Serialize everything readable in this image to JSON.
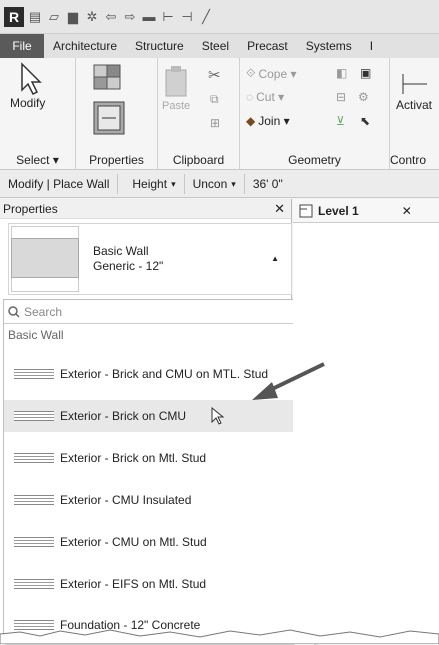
{
  "qat": {
    "logo": "R"
  },
  "tabs": [
    "File",
    "Architecture",
    "Structure",
    "Steel",
    "Precast",
    "Systems",
    "I"
  ],
  "ribbon": {
    "select": {
      "modify": "Modify",
      "label": "Select ▾"
    },
    "properties": {
      "label": "Properties"
    },
    "clipboard": {
      "paste": "Paste",
      "label": "Clipboard"
    },
    "geometry": {
      "cope": "Cope ▾",
      "cut": "Cut ▾",
      "join": "Join ▾",
      "label": "Geometry"
    },
    "controls": {
      "activate": "Activat",
      "label": "Contro"
    }
  },
  "options_bar": {
    "context": "Modify | Place Wall",
    "height": "Height",
    "uncon": "Uncon",
    "length": "36' 0\""
  },
  "properties": {
    "title": "Properties",
    "family": "Basic Wall",
    "type": "Generic - 12\"",
    "search_placeholder": "Search",
    "group": "Basic Wall",
    "items": [
      "Exterior - Brick and CMU on MTL. Stud",
      "Exterior - Brick on CMU",
      "Exterior - Brick on Mtl. Stud",
      "Exterior - CMU Insulated",
      "Exterior - CMU on Mtl. Stud",
      "Exterior - EIFS on Mtl. Stud",
      "Foundation - 12\" Concrete"
    ]
  },
  "view": {
    "tab": "Level 1"
  }
}
